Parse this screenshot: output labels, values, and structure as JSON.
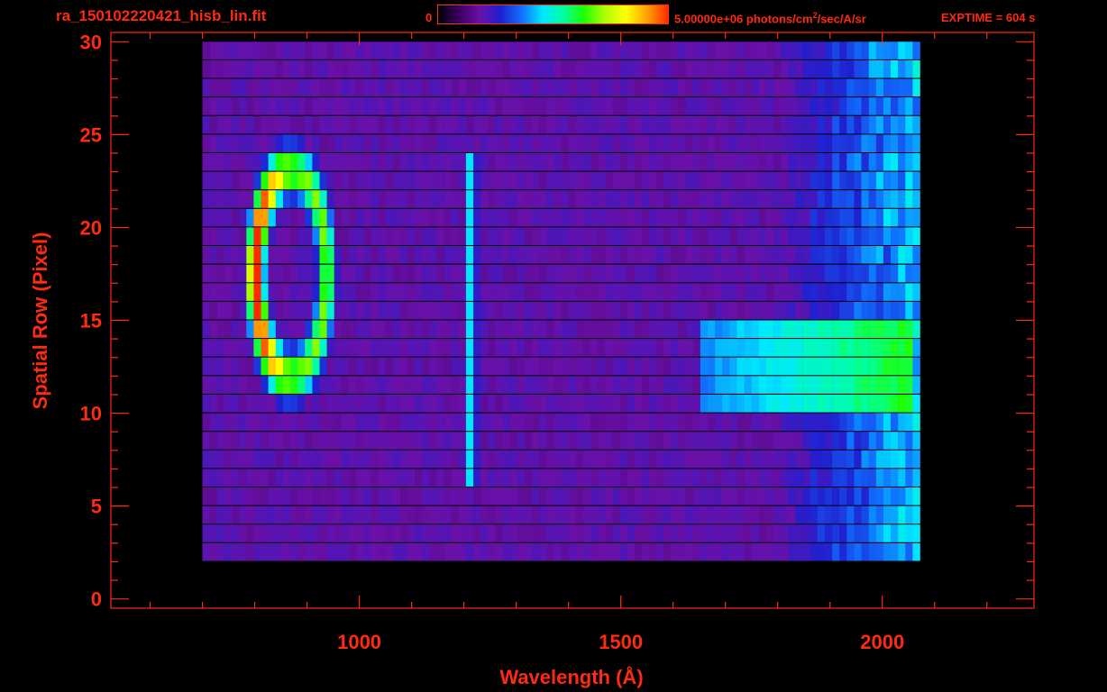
{
  "header": {
    "filename": "ra_150102220421_hisb_lin.fit",
    "colorbar_min": "0",
    "colorbar_max_value": "5.00000e+06 photons/cm",
    "colorbar_max_exp": "2",
    "colorbar_max_unit": "/sec/A/sr",
    "exptime": "EXPTIME = 604 s"
  },
  "colors": {
    "axis": "#ff2a10",
    "background": "#000000",
    "colormap": [
      "#000000",
      "#3a0060",
      "#6a10a8",
      "#2020d0",
      "#1070ff",
      "#00e8ff",
      "#00ffa0",
      "#20ff00",
      "#b0ff00",
      "#ffff00",
      "#ffa000",
      "#ff2a00"
    ]
  },
  "chart_data": {
    "type": "heatmap",
    "title": "ra_150102220421_hisb_lin.fit",
    "xlabel": "Wavelength (Å)",
    "ylabel": "Spatial Row (Pixel)",
    "xlim": [
      525,
      2290
    ],
    "ylim": [
      -0.5,
      30.5
    ],
    "xticks": [
      1000,
      1500,
      2000
    ],
    "yticks": [
      0,
      5,
      10,
      15,
      20,
      25,
      30
    ],
    "colorbar": {
      "min": 0,
      "max": 5000000,
      "unit": "photons/cm^2/sec/A/sr"
    },
    "data_extent": {
      "wavelength": [
        700,
        2060
      ],
      "rows": [
        2,
        30
      ]
    },
    "features": [
      {
        "name": "oval emission",
        "wavelength_range": [
          790,
          950
        ],
        "row_range": [
          11,
          24
        ],
        "peak_level": 1.0
      },
      {
        "name": "narrow line",
        "wavelength": 1216,
        "row_range": [
          6,
          24
        ],
        "peak_level": 0.55
      },
      {
        "name": "continuum band",
        "wavelength_range": [
          1650,
          2060
        ],
        "row_range": [
          10,
          15
        ],
        "peak_level": 0.6
      }
    ],
    "grid": false
  }
}
